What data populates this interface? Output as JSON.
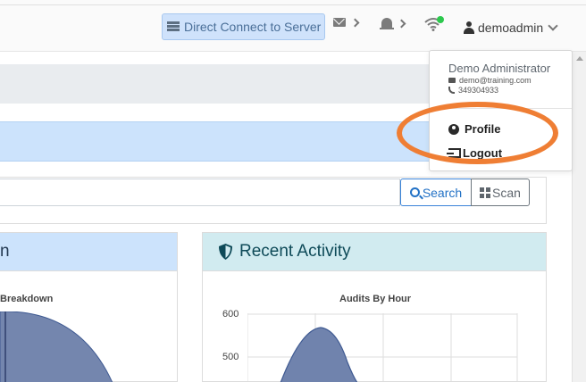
{
  "header": {
    "direct_connect_label": "Direct Connect to Server",
    "user_name": "demoadmin",
    "online_indicator_color": "#2cc84d"
  },
  "user_menu": {
    "full_name": "Demo Administrator",
    "email": "demo@training.com",
    "phone": "349304933",
    "items": [
      {
        "label": "Profile",
        "icon": "profile-icon"
      },
      {
        "label": "Logout",
        "icon": "logout-icon"
      }
    ]
  },
  "search": {
    "placeholder": "",
    "search_label": "Search",
    "scan_label": "Scan"
  },
  "cards": {
    "left_title": "n",
    "right_title": "Recent Activity"
  },
  "charts": {
    "left_chart_title": "Breakdown",
    "right_chart_title": "Audits By Hour"
  },
  "chart_data": {
    "type": "area",
    "title": "Audits By Hour",
    "y_ticks": [
      500,
      600
    ],
    "series_color": "#7083ad"
  },
  "annotation": {
    "highlight_color": "#ef7e34",
    "target": "Profile / Logout"
  }
}
